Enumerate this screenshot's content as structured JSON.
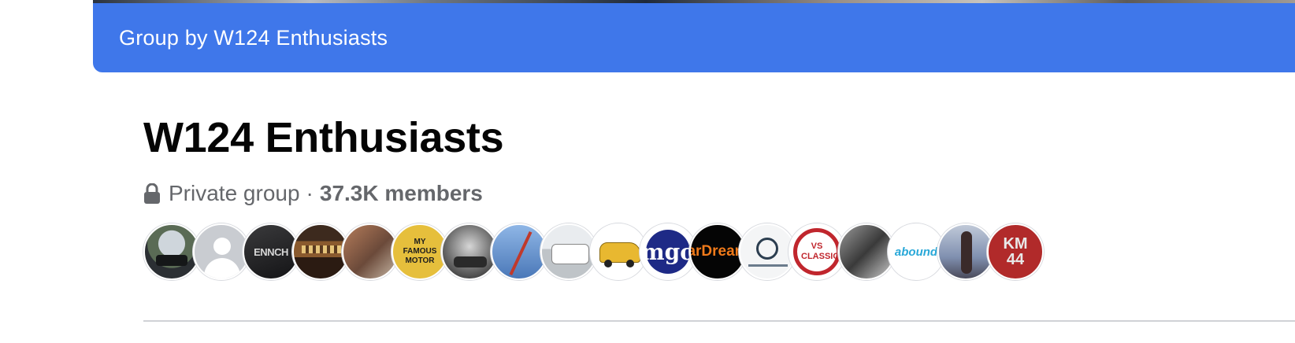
{
  "banner": {
    "text": "Group by W124 Enthusiasts"
  },
  "group": {
    "title": "W124 Enthusiasts",
    "privacy_icon": "lock-icon",
    "privacy": "Private group",
    "separator": "·",
    "members": "37.3K members"
  },
  "avatars": [
    {
      "text": ""
    },
    {
      "text": ""
    },
    {
      "text": "ENNCH"
    },
    {
      "text": ""
    },
    {
      "text": ""
    },
    {
      "text": "MY FAMOUS MOTOR"
    },
    {
      "text": ""
    },
    {
      "text": ""
    },
    {
      "text": ""
    },
    {
      "text": ""
    },
    {
      "text": "mgo"
    },
    {
      "text": "arDream"
    },
    {
      "text": ""
    },
    {
      "text": "VS CLASSICS"
    },
    {
      "text": ""
    },
    {
      "text": "abound"
    },
    {
      "text": ""
    },
    {
      "text": "KM 44"
    }
  ],
  "colors": {
    "banner": "#3f77ea",
    "muted_text": "#65676b",
    "title_text": "#050505"
  }
}
